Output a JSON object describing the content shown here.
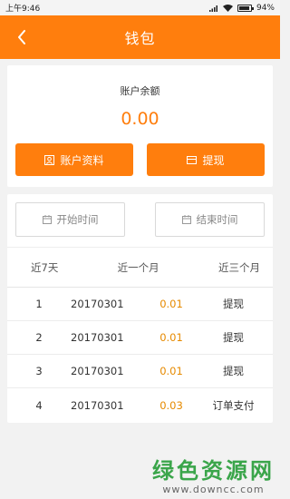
{
  "status_bar": {
    "time": "上午9:46",
    "battery": "94%"
  },
  "header": {
    "title": "钱包"
  },
  "balance": {
    "label": "账户余额",
    "value": "0.00",
    "profile_button": "账户资料",
    "withdraw_button": "提现"
  },
  "filters": {
    "start_time": "开始时间",
    "end_time": "结束时间",
    "ranges": [
      "近7天",
      "近一个月",
      "近三个月"
    ]
  },
  "transactions": [
    {
      "index": "1",
      "date": "20170301",
      "amount": "0.01",
      "type": "提现"
    },
    {
      "index": "2",
      "date": "20170301",
      "amount": "0.01",
      "type": "提现"
    },
    {
      "index": "3",
      "date": "20170301",
      "amount": "0.01",
      "type": "提现"
    },
    {
      "index": "4",
      "date": "20170301",
      "amount": "0.03",
      "type": "订单支付"
    }
  ],
  "watermark": {
    "main": "绿色资源网",
    "sub": "www.downcc.com"
  },
  "colors": {
    "accent": "#ff7e0d",
    "amount": "#e68a00",
    "watermark": "#3aa54a"
  }
}
